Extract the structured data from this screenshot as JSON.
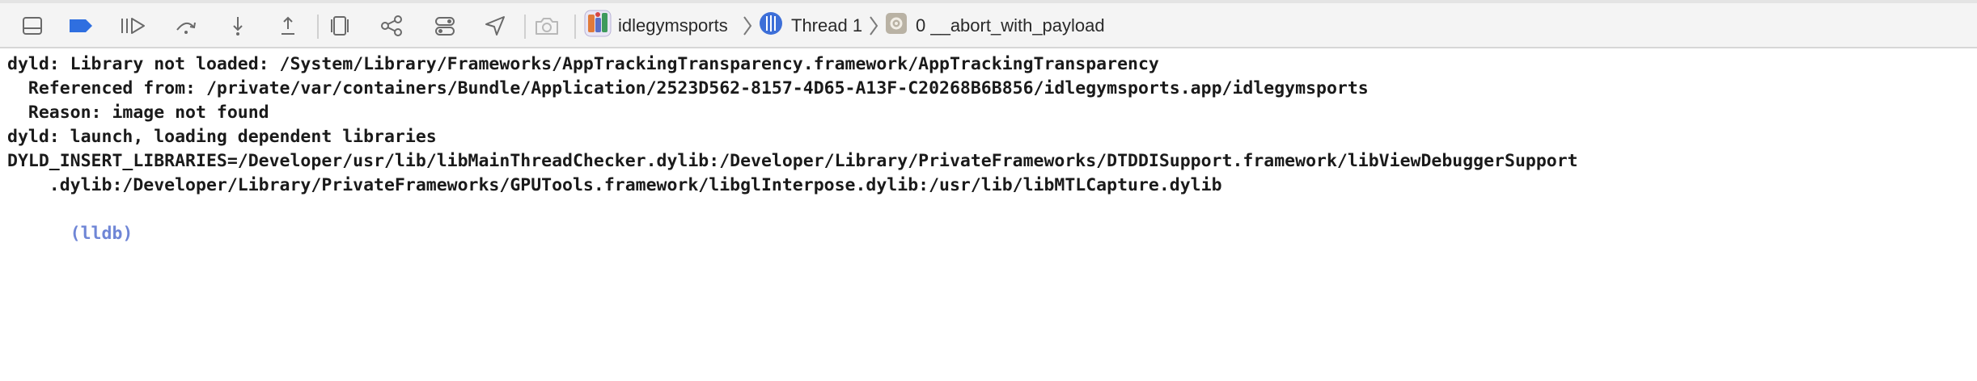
{
  "toolbar": {
    "buttons": [
      {
        "icon": "hide-debug-area-icon"
      },
      {
        "icon": "breakpoints-toggle-icon",
        "active_color": "#2f6fe0"
      },
      {
        "icon": "continue-execution-icon"
      },
      {
        "icon": "step-over-icon"
      },
      {
        "icon": "step-into-icon"
      },
      {
        "icon": "step-out-icon"
      },
      {
        "icon": "debug-view-hierarchy-icon"
      },
      {
        "icon": "debug-memory-graph-icon"
      },
      {
        "icon": "environment-overrides-icon"
      },
      {
        "icon": "simulate-location-icon"
      },
      {
        "icon": "camera-icon"
      }
    ],
    "breadcrumb": {
      "app": "idlegymsports",
      "thread": "Thread 1",
      "frame": "0 __abort_with_payload"
    }
  },
  "console": {
    "lines": [
      "dyld: Library not loaded: /System/Library/Frameworks/AppTrackingTransparency.framework/AppTrackingTransparency",
      "  Referenced from: /private/var/containers/Bundle/Application/2523D562-8157-4D65-A13F-C20268B6B856/idlegymsports.app/idlegymsports",
      "  Reason: image not found",
      "dyld: launch, loading dependent libraries",
      "DYLD_INSERT_LIBRARIES=/Developer/usr/lib/libMainThreadChecker.dylib:/Developer/Library/PrivateFrameworks/DTDDISupport.framework/libViewDebuggerSupport",
      "    .dylib:/Developer/Library/PrivateFrameworks/GPUTools.framework/libglInterpose.dylib:/usr/lib/libMTLCapture.dylib"
    ],
    "prompt": "(lldb)",
    "prompt_color": "#6f86d6"
  }
}
